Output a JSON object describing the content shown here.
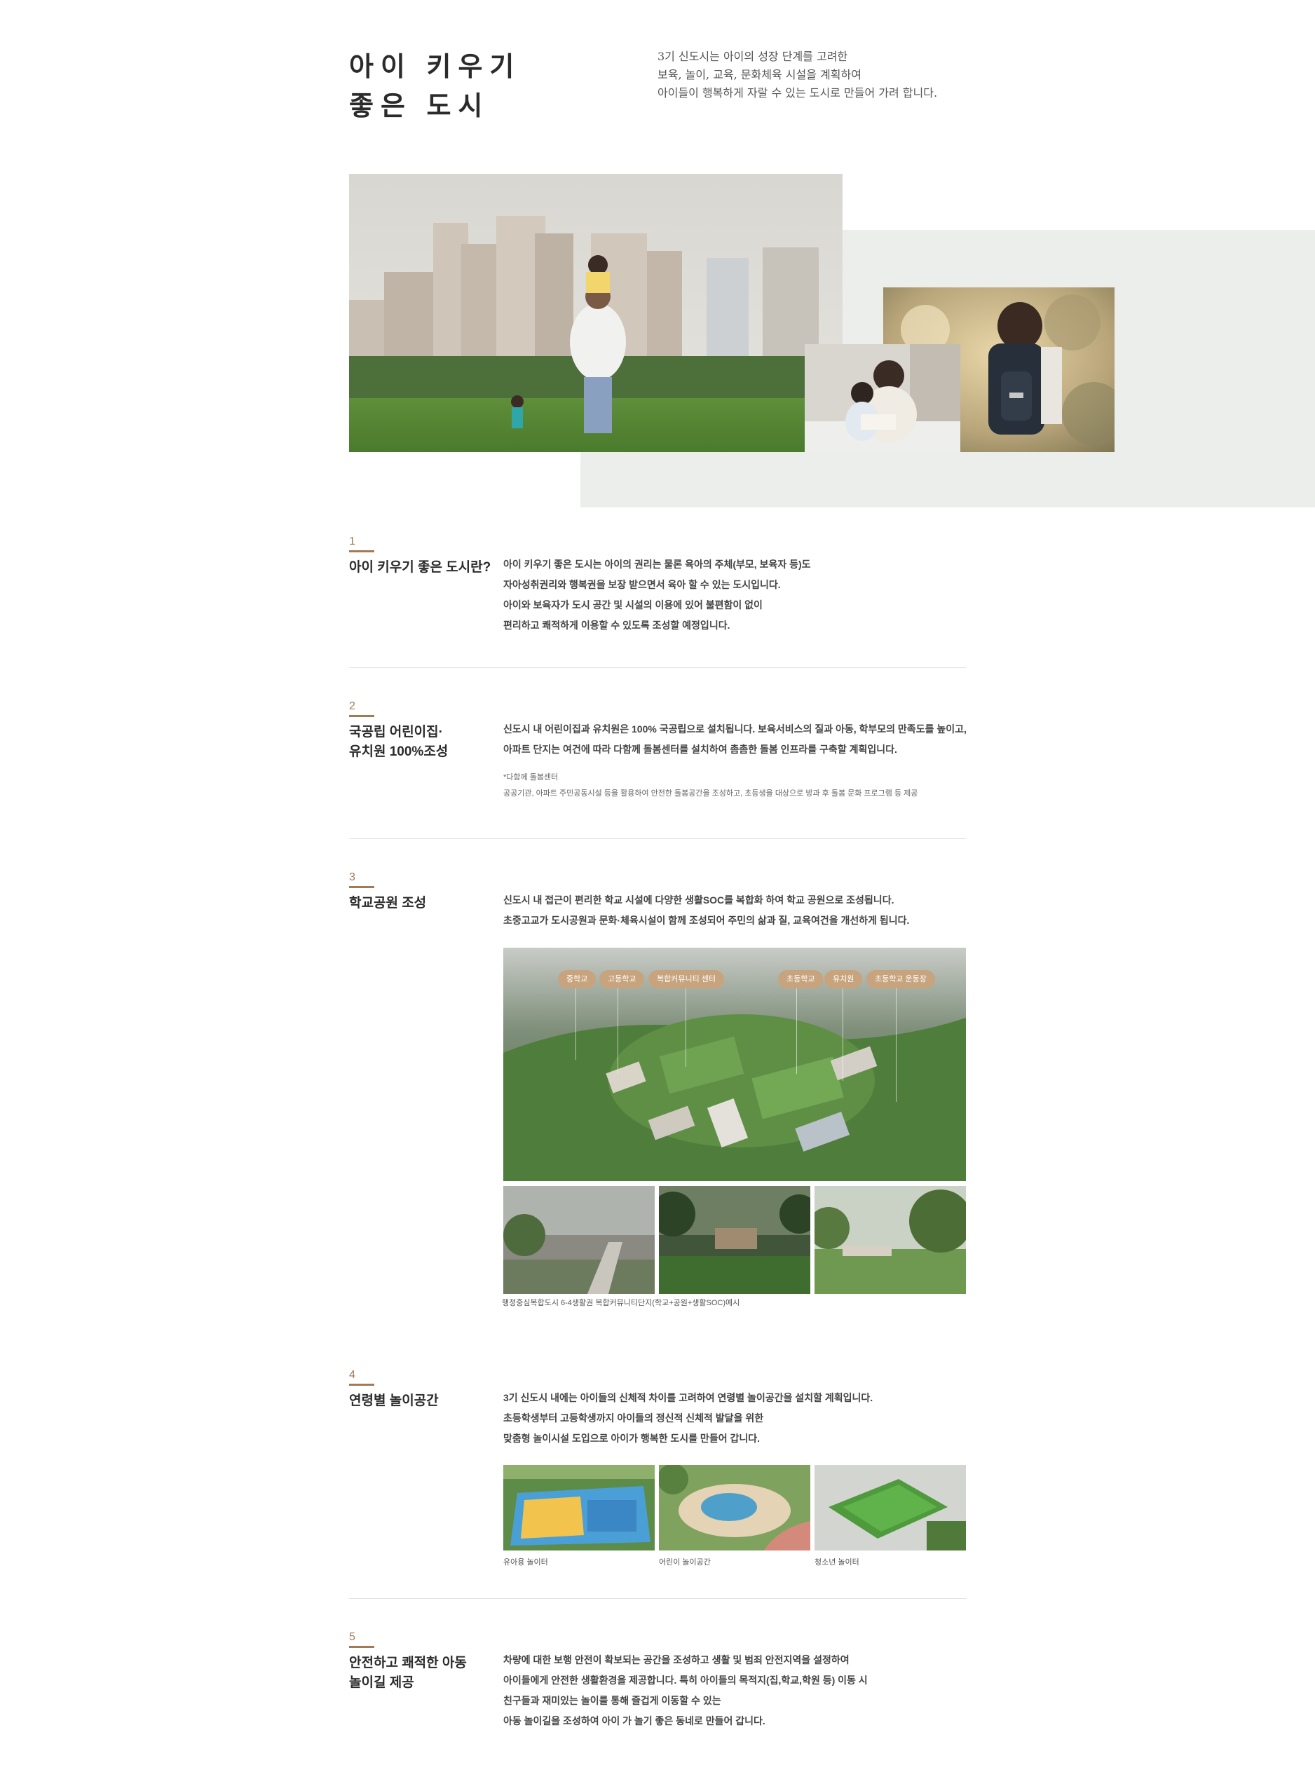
{
  "hero": {
    "title_line1": "아이 키우기",
    "title_line2": "좋은 도시",
    "desc_line1": "3기 신도시는 아이의 성장 단계를 고려한",
    "desc_line2": "보육, 놀이, 교육, 문화체육 시설을 계획하여",
    "desc_line3": "아이들이 행복하게 자랄 수 있는 도시로 만들어 가려 합니다."
  },
  "sections": [
    {
      "num": "1",
      "title": [
        "아이 키우기 좋은 도시란?"
      ],
      "body": [
        "아이 키우기 좋은 도시는 아이의 권리는 물론 육아의 주체(부모, 보육자 등)도",
        "자아성취권리와 행복권을 보장 받으면서 육아 할 수 있는 도시입니다.",
        "아이와 보육자가 도시 공간 및 시설의 이용에 있어 불편함이 없이",
        "편리하고 쾌적하게 이용할 수 있도록 조성할 예정입니다."
      ]
    },
    {
      "num": "2",
      "title": [
        "국공립 어린이집·",
        "유치원 100%조성"
      ],
      "body": [
        "신도시 내 어린이집과 유치원은 100% 국공립으로 설치됩니다. 보육서비스의 질과 아동, 학부모의 만족도를 높이고,",
        "아파트 단지는 여건에 따라 다함께 돌봄센터를 설치하여 촘촘한 돌봄 인프라를 구축할 계획입니다."
      ],
      "note": [
        "*다함께 돌봄센터",
        "공공기관, 아파트 주민공동시설 등을 활용하여 안전한 돌봄공간을 조성하고, 초등생을 대상으로 방과 후 돌봄 문화 프로그램 등 제공"
      ]
    },
    {
      "num": "3",
      "title": [
        "학교공원 조성"
      ],
      "body": [
        "신도시 내 접근이 편리한 학교 시설에 다양한 생활SOC를 복합화 하여 학교 공원으로 조성됩니다.",
        "초중고교가 도시공원과 문화·체육시설이 함께 조성되어 주민의 삶과 질, 교육여건을 개선하게 됩니다."
      ],
      "tags": [
        "중학교",
        "고등학교",
        "복합커뮤니티 센터",
        "초등학교",
        "유치원",
        "초등학교 운동장"
      ],
      "caption": "행정중심복합도시 6-4생활권 복합커뮤니티단지(학교+공원+생활SOC)예시"
    },
    {
      "num": "4",
      "title": [
        "연령별 놀이공간"
      ],
      "body": [
        "3기 신도시 내에는 아이들의 신체적 차이를 고려하여 연령별 놀이공간을 설치할 계획입니다.",
        "초등학생부터 고등학생까지 아이들의 정신적 신체적 발달을 위한",
        "맞춤형 놀이시설 도입으로 아이가 행복한 도시를 만들어 갑니다."
      ],
      "captions": [
        "유아용 놀이터",
        "어린이 놀이공간",
        "청소년 놀이터"
      ]
    },
    {
      "num": "5",
      "title": [
        "안전하고 쾌적한 아동",
        "놀이길 제공"
      ],
      "body": [
        "차량에 대한 보행 안전이 확보되는 공간을 조성하고 생활 및 범죄 안전지역을 설정하여",
        "아이들에게 안전한 생활환경을 제공합니다. 특히 아이들의 목적지(집,학교,학원 등) 이동 시",
        "친구들과 재미있는 놀이를 통해 즐겁게 이동할 수 있는",
        "아동 놀이길을 조성하여 아이 가 놀기 좋은 동네로 만들어 갑니다."
      ]
    }
  ],
  "colors": {
    "accent": "#a47a56",
    "tag": "#c7a47d",
    "panel": "#eceeec"
  }
}
